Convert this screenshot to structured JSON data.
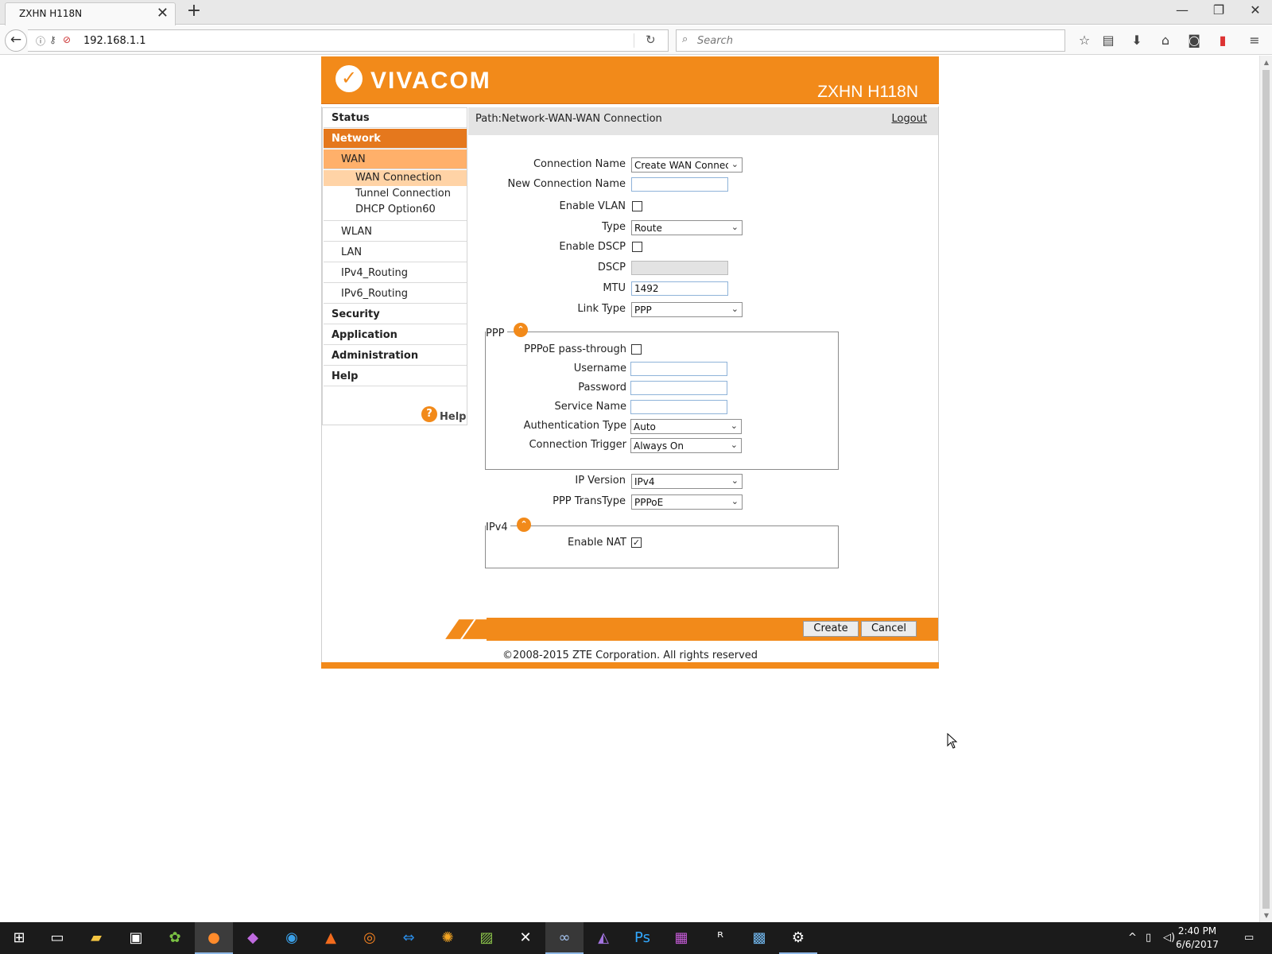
{
  "browser": {
    "tab_title": "ZXHN H118N",
    "tab_close": "✕",
    "new_tab": "+",
    "minimize": "—",
    "restore": "❐",
    "close": "✕",
    "url": "192.168.1.1",
    "search_placeholder": "Search"
  },
  "header": {
    "brand": "VIVACOM",
    "model": "ZXHN H118N"
  },
  "sidebar": {
    "status": "Status",
    "network": "Network",
    "wan": "WAN",
    "wan_connection": "WAN Connection",
    "tunnel_connection": "Tunnel Connection",
    "dhcp_option60": "DHCP Option60",
    "wlan": "WLAN",
    "lan": "LAN",
    "ipv4_routing": "IPv4_Routing",
    "ipv6_routing": "IPv6_Routing",
    "security": "Security",
    "application": "Application",
    "administration": "Administration",
    "help": "Help",
    "help_link": "Help"
  },
  "path": {
    "text": "Path:Network-WAN-WAN Connection",
    "logout": "Logout"
  },
  "form": {
    "connection_name_label": "Connection Name",
    "connection_name_value": "Create WAN Connection",
    "new_connection_name_label": "New Connection Name",
    "new_connection_name_value": "",
    "enable_vlan_label": "Enable VLAN",
    "enable_vlan_checked": false,
    "type_label": "Type",
    "type_value": "Route",
    "enable_dscp_label": "Enable DSCP",
    "enable_dscp_checked": false,
    "dscp_label": "DSCP",
    "dscp_value": "",
    "mtu_label": "MTU",
    "mtu_value": "1492",
    "link_type_label": "Link Type",
    "link_type_value": "PPP",
    "ppp_legend": "PPP",
    "pppoe_passthrough_label": "PPPoE pass-through",
    "pppoe_passthrough_checked": false,
    "username_label": "Username",
    "username_value": "",
    "password_label": "Password",
    "password_value": "",
    "service_name_label": "Service Name",
    "service_name_value": "",
    "auth_type_label": "Authentication Type",
    "auth_type_value": "Auto",
    "conn_trigger_label": "Connection Trigger",
    "conn_trigger_value": "Always On",
    "ip_version_label": "IP Version",
    "ip_version_value": "IPv4",
    "ppp_transtype_label": "PPP TransType",
    "ppp_transtype_value": "PPPoE",
    "ipv4_legend": "IPv4",
    "enable_nat_label": "Enable NAT",
    "enable_nat_checked": true,
    "collapse_glyph": "⌃"
  },
  "buttons": {
    "create": "Create",
    "cancel": "Cancel"
  },
  "footer": {
    "copyright": "©2008-2015 ZTE Corporation. All rights reserved"
  },
  "taskbar": {
    "time": "2:40 PM",
    "date": "6/6/2017"
  },
  "colors": {
    "brand_orange": "#f28a1a",
    "nav_selected": "#e5781d",
    "nav_wan": "#ffb06a",
    "nav_leaf_active": "#ffd3a6"
  }
}
